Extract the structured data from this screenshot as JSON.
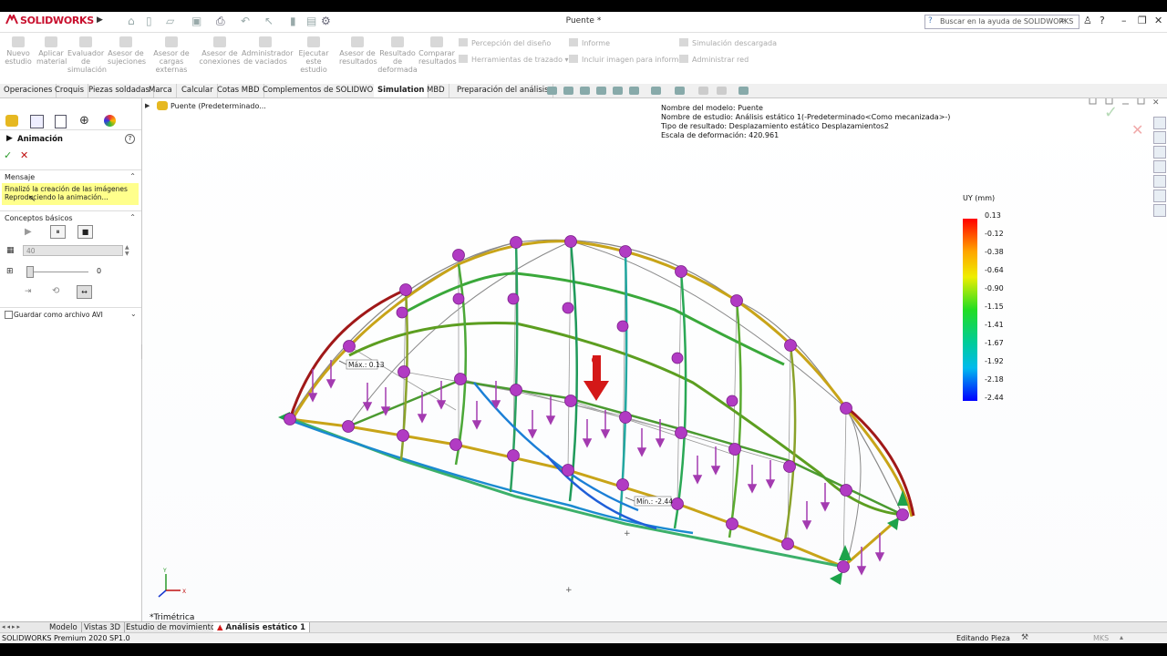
{
  "title_bar": {
    "brand": "SOLIDWORKS",
    "doc_title": "Puente *",
    "search_placeholder": "Buscar en la ayuda de SOLIDWORKS"
  },
  "ribbon": {
    "buttons": [
      {
        "label": "Nuevo estudio"
      },
      {
        "label": "Aplicar material"
      },
      {
        "label": "Evaluador de simulación"
      },
      {
        "label": "Asesor de sujeciones"
      },
      {
        "label": "Asesor de cargas externas"
      },
      {
        "label": "Asesor de conexiones"
      },
      {
        "label": "Administrador de vaciados"
      },
      {
        "label": "Ejecutar este estudio"
      },
      {
        "label": "Asesor de resultados"
      },
      {
        "label": "Resultado de deformada"
      },
      {
        "label": "Comparar resultados"
      }
    ],
    "small": {
      "percepcion": "Percepción del diseño",
      "herramientas": "Herramientas de trazado",
      "informe": "Informe",
      "incluir": "Incluir imagen para informe",
      "simulacion_desc": "Simulación descargada",
      "administrar": "Administrar red"
    }
  },
  "tabs": [
    "Operaciones",
    "Croquis",
    "Piezas soldadas",
    "Marca",
    "Calcular",
    "Cotas MBD",
    "Complementos de SOLIDWORKS",
    "Simulation",
    "MBD",
    "Preparación del análisis"
  ],
  "active_tab": "Simulation",
  "left_panel": {
    "title": "Animación",
    "mensaje_header": "Mensaje",
    "mensaje_lines": [
      "Finalizó la creación de las imágenes",
      "Reproduciendo la animación..."
    ],
    "conceptos_header": "Conceptos básicos",
    "frames_value": "40",
    "slider_value": "0",
    "avi_label": "Guardar como archivo AVI"
  },
  "viewport": {
    "tree_item": "Puente  (Predeterminado...",
    "info_lines": [
      "Nombre del modelo: Puente",
      "Nombre de estudio: Análisis estático 1(-Predeterminado<Como mecanizada>-)",
      "Tipo de resultado: Desplazamiento estático Desplazamientos2",
      "Escala de deformación: 420.961"
    ],
    "legend_title": "UY (mm)",
    "legend_values": [
      "0.13",
      "-0.12",
      "-0.38",
      "-0.64",
      "-0.90",
      "-1.15",
      "-1.41",
      "-1.67",
      "-1.92",
      "-2.18",
      "-2.44"
    ],
    "max_label": "Máx.: 0.13",
    "min_label": "Mín.: -2.44",
    "view_name": "*Trimétrica"
  },
  "bottom_tabs": [
    "Modelo",
    "Vistas 3D",
    "Estudio de movimiento 1",
    "Análisis estático 1"
  ],
  "active_bottom_tab": "Análisis estático 1",
  "status": {
    "left": "SOLIDWORKS Premium 2020 SP1.0",
    "mode": "Editando Pieza",
    "units": "MKS"
  },
  "colors": {
    "accent_red": "#c8102e",
    "legend_top": "#ff0000",
    "legend_mid": "#00ff00",
    "legend_bottom": "#0000ff",
    "node_magenta": "#b13bc3"
  }
}
